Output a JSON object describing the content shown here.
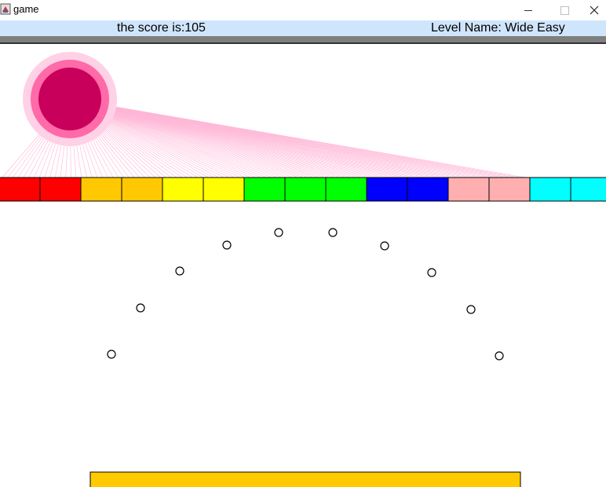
{
  "window": {
    "title": "game",
    "controls": {
      "minimize": "minimize-icon",
      "maximize": "maximize-icon",
      "close": "close-icon"
    }
  },
  "status": {
    "score_label": "the score is:105",
    "level_label": "Level Name: Wide Easy"
  },
  "colors": {
    "statusbar_bg": "#cfe5fb",
    "wall": "#7f7f7f",
    "sun_outer": "#ffd1e6",
    "sun_mid": "#ff6aa8",
    "sun_inner": "#c8005c",
    "sun_rays": "#ffb6d6",
    "paddle": "#ffca00"
  },
  "blocks": [
    {
      "color": "#ff0000"
    },
    {
      "color": "#ff0000"
    },
    {
      "color": "#ffc800"
    },
    {
      "color": "#ffc800"
    },
    {
      "color": "#ffff00"
    },
    {
      "color": "#ffff00"
    },
    {
      "color": "#00ff00"
    },
    {
      "color": "#00ff00"
    },
    {
      "color": "#00ff00"
    },
    {
      "color": "#0000ff"
    },
    {
      "color": "#0000ff"
    },
    {
      "color": "#ffafaf"
    },
    {
      "color": "#ffafaf"
    },
    {
      "color": "#00ffff"
    },
    {
      "color": "#00ffff"
    }
  ],
  "ball_count": 10
}
